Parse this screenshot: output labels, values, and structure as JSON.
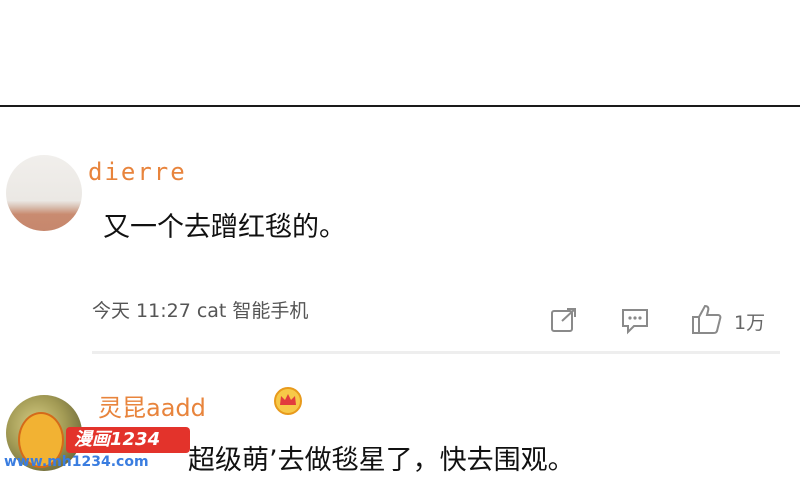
{
  "comments": [
    {
      "username": "dierre",
      "text": "又一个去蹭红毯的。",
      "meta": "今天 11:27 cat 智能手机",
      "like_count": "1万"
    },
    {
      "username": "灵昆aadd",
      "text": "超级萌’去做毯星了，快去围观。"
    }
  ],
  "watermark": {
    "brand": "漫画1234",
    "url": "www.mh1234.com"
  },
  "icons": {
    "share": "share-icon",
    "reply": "comment-icon",
    "like": "thumbs-up-icon",
    "badge": "crown-icon"
  },
  "colors": {
    "username": "#e8843c",
    "watermark_red": "#e3332b",
    "watermark_blue": "#3a7de0"
  }
}
